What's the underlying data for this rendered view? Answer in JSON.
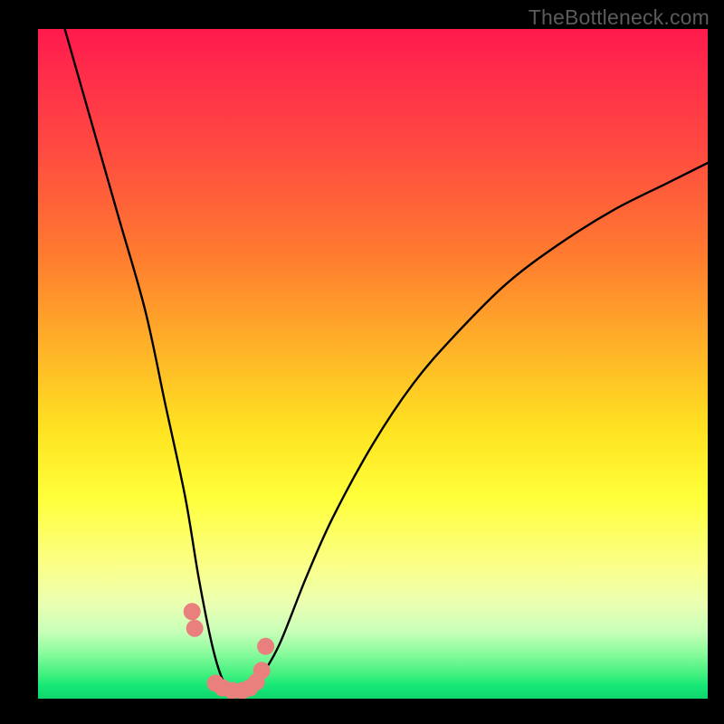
{
  "watermark": "TheBottleneck.com",
  "chart_data": {
    "type": "line",
    "title": "",
    "xlabel": "",
    "ylabel": "",
    "xlim": [
      0,
      100
    ],
    "ylim": [
      0,
      100
    ],
    "series": [
      {
        "name": "bottleneck-curve",
        "x": [
          4,
          8,
          12,
          16,
          19,
          22,
          24,
          26,
          27.5,
          29,
          31,
          33,
          36,
          40,
          44,
          50,
          56,
          62,
          70,
          78,
          86,
          94,
          100
        ],
        "values": [
          100,
          86,
          72,
          58,
          44,
          30,
          18,
          8,
          3,
          1,
          1,
          3,
          8,
          18,
          27,
          38,
          47,
          54,
          62,
          68,
          73,
          77,
          80
        ]
      }
    ],
    "markers": {
      "name": "highlight-dots",
      "x": [
        23.0,
        23.4,
        26.5,
        27.6,
        29.0,
        30.5,
        31.6,
        32.6,
        33.4,
        34.0
      ],
      "values": [
        13.0,
        10.5,
        2.3,
        1.6,
        1.2,
        1.2,
        1.6,
        2.5,
        4.2,
        7.8
      ]
    },
    "gradient_stops": [
      {
        "pos": 0.0,
        "color": "#ff1a4d"
      },
      {
        "pos": 0.34,
        "color": "#ff7c2f"
      },
      {
        "pos": 0.6,
        "color": "#ffe321"
      },
      {
        "pos": 0.86,
        "color": "#e9ffb3"
      },
      {
        "pos": 1.0,
        "color": "#0fd66e"
      }
    ]
  }
}
